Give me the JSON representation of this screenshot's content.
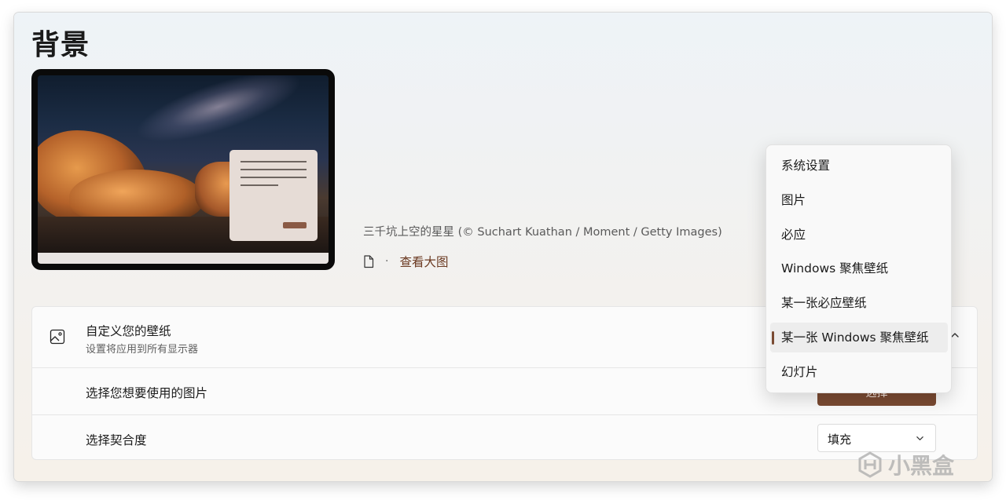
{
  "page": {
    "title": "背景"
  },
  "wallpaper": {
    "caption": "三千坑上空的星星 (© Suchart Kuathan / Moment / Getty Images)",
    "view_link": "查看大图",
    "separator": "·"
  },
  "personalize": {
    "title": "自定义您的壁纸",
    "subtitle": "设置将应用到所有显示器",
    "rows": [
      {
        "label": "选择您想要使用的图片",
        "button": "选择"
      },
      {
        "label": "选择契合度",
        "value": "填充"
      }
    ]
  },
  "dropdown": {
    "options": [
      "系统设置",
      "图片",
      "必应",
      "Windows 聚焦壁纸",
      "某一张必应壁纸",
      "某一张 Windows 聚焦壁纸",
      "幻灯片"
    ],
    "selected": "某一张 Windows 聚焦壁纸"
  },
  "watermark": {
    "text": "小黑盒"
  },
  "colors": {
    "accent": "#7a4a32",
    "link": "#6b3a22"
  }
}
